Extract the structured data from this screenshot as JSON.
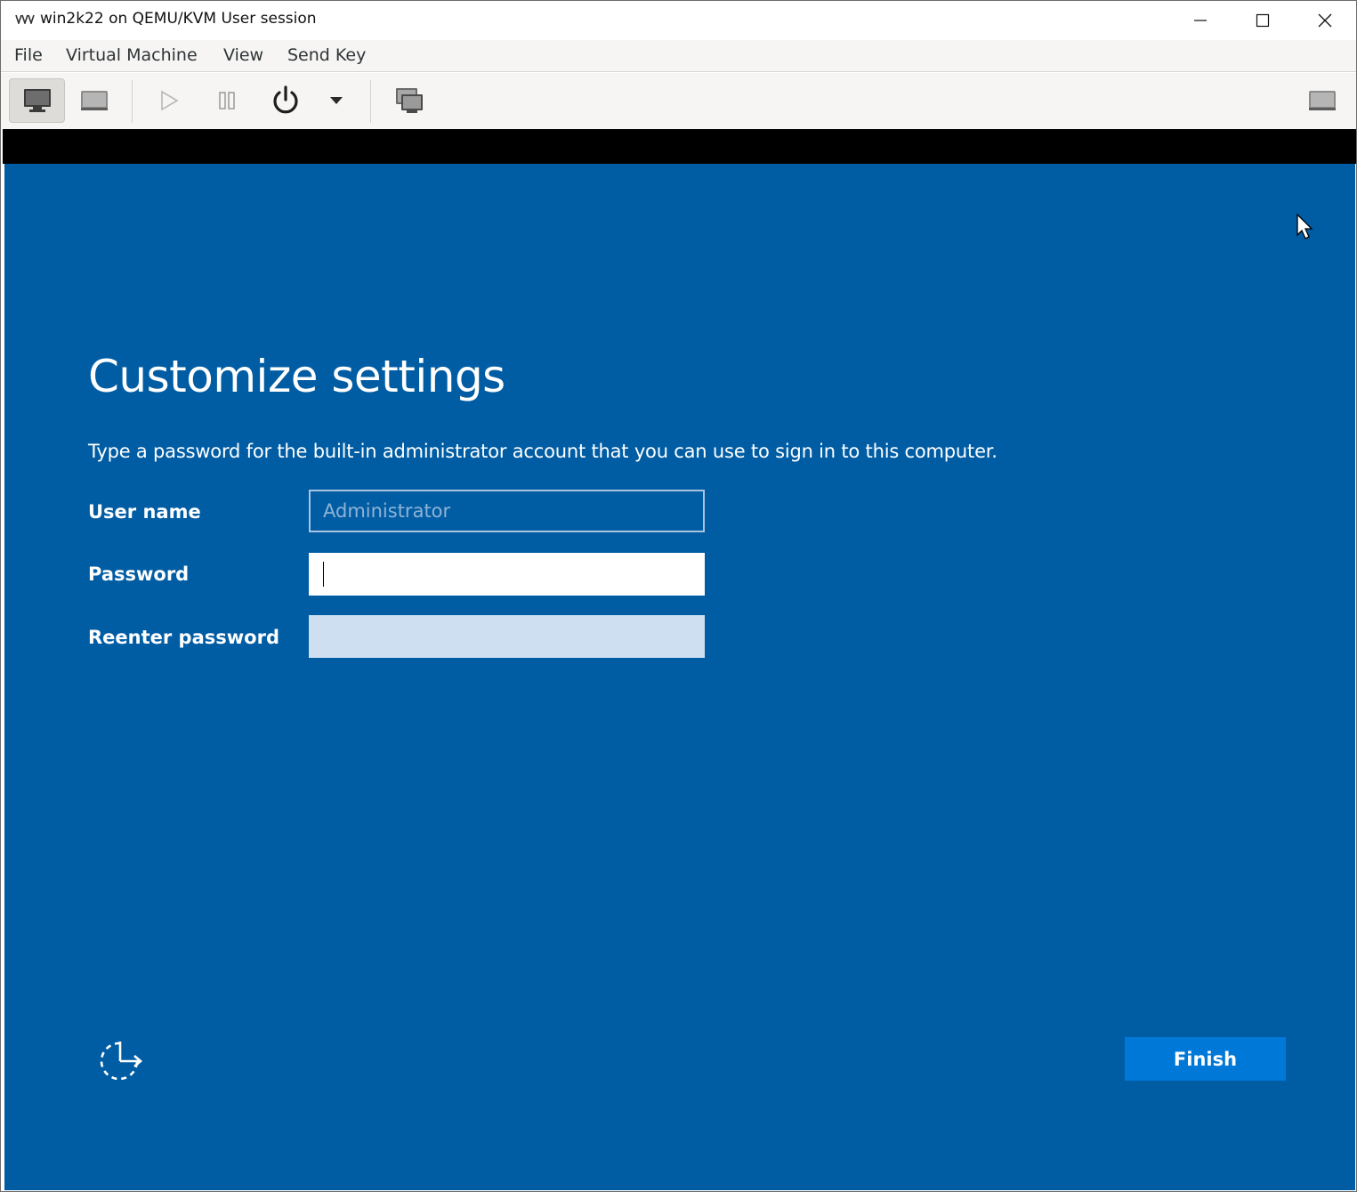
{
  "window": {
    "title": "win2k22 on QEMU/KVM User session",
    "controls": {
      "minimize": "minimize",
      "maximize": "maximize",
      "close": "close"
    }
  },
  "menubar": {
    "items": [
      {
        "label": "File"
      },
      {
        "label": "Virtual Machine"
      },
      {
        "label": "View"
      },
      {
        "label": "Send Key"
      }
    ]
  },
  "toolbar": {
    "buttons": [
      {
        "icon": "monitor-icon",
        "active": true
      },
      {
        "icon": "details-icon",
        "active": false
      },
      {
        "icon": "play-icon",
        "active": false
      },
      {
        "icon": "pause-icon",
        "active": false
      },
      {
        "icon": "power-icon",
        "active": false
      },
      {
        "icon": "chevron-down-icon",
        "active": false
      },
      {
        "icon": "snapshots-icon",
        "active": false
      },
      {
        "icon": "fullscreen-icon",
        "active": false
      }
    ]
  },
  "setup": {
    "heading": "Customize settings",
    "description": "Type a password for the built-in administrator account that you can use to sign in to this computer.",
    "username_label": "User name",
    "username_placeholder": "Administrator",
    "password_label": "Password",
    "password_value": "",
    "reenter_label": "Reenter password",
    "reenter_value": "",
    "finish_label": "Finish"
  },
  "colors": {
    "background": "#005da4",
    "accent_button": "#0078d7",
    "reenter_field": "#cddff0"
  }
}
